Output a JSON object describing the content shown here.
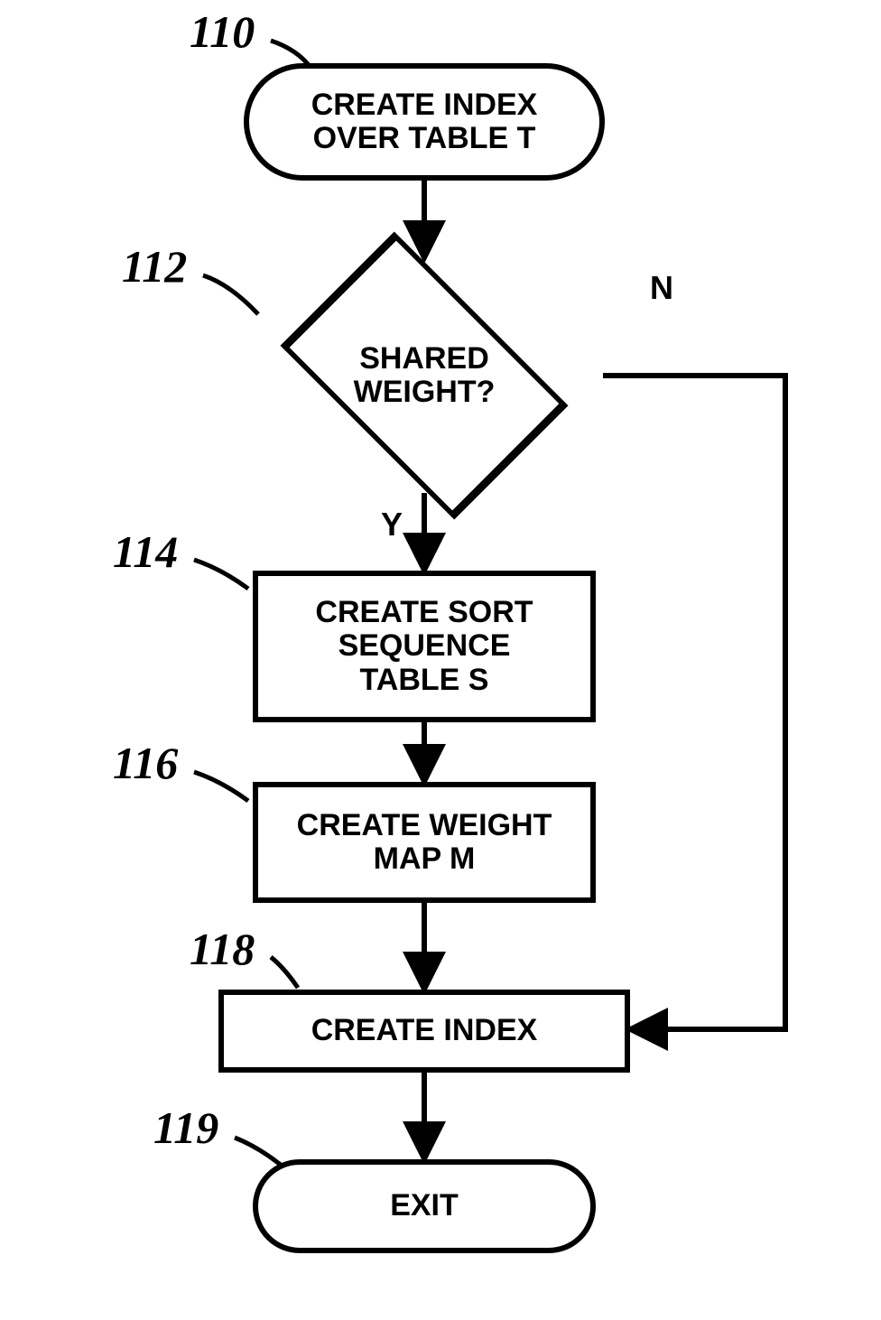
{
  "chart_data": {
    "type": "flowchart",
    "nodes": [
      {
        "id": "n110",
        "kind": "terminator",
        "label": "CREATE INDEX OVER TABLE T",
        "callout": "110"
      },
      {
        "id": "n112",
        "kind": "decision",
        "label": "SHARED WEIGHT?",
        "callout": "112"
      },
      {
        "id": "n114",
        "kind": "process",
        "label": "CREATE SORT SEQUENCE TABLE S",
        "callout": "114"
      },
      {
        "id": "n116",
        "kind": "process",
        "label": "CREATE WEIGHT MAP M",
        "callout": "116"
      },
      {
        "id": "n118",
        "kind": "process",
        "label": "CREATE INDEX",
        "callout": "118"
      },
      {
        "id": "n119",
        "kind": "terminator",
        "label": "EXIT",
        "callout": "119"
      }
    ],
    "edges": [
      {
        "from": "n110",
        "to": "n112",
        "label": ""
      },
      {
        "from": "n112",
        "to": "n114",
        "label": "Y"
      },
      {
        "from": "n112",
        "to": "n118",
        "label": "N"
      },
      {
        "from": "n114",
        "to": "n116",
        "label": ""
      },
      {
        "from": "n116",
        "to": "n118",
        "label": ""
      },
      {
        "from": "n118",
        "to": "n119",
        "label": ""
      }
    ]
  },
  "nodes": {
    "n110": {
      "label": "CREATE INDEX\nOVER TABLE T",
      "callout": "110"
    },
    "n112": {
      "label": "SHARED\nWEIGHT?",
      "callout": "112"
    },
    "n114": {
      "label": "CREATE SORT\nSEQUENCE\nTABLE S",
      "callout": "114"
    },
    "n116": {
      "label": "CREATE WEIGHT\nMAP M",
      "callout": "116"
    },
    "n118": {
      "label": "CREATE INDEX",
      "callout": "118"
    },
    "n119": {
      "label": "EXIT",
      "callout": "119"
    }
  },
  "edge_labels": {
    "yes": "Y",
    "no": "N"
  }
}
